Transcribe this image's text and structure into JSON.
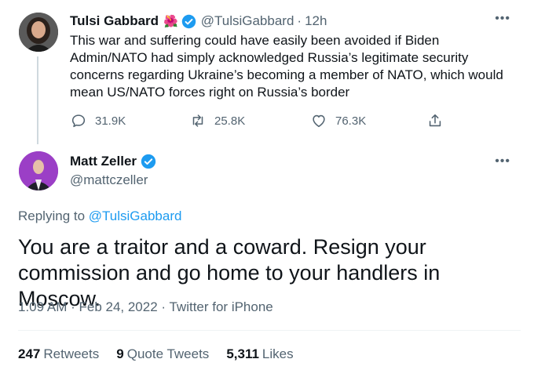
{
  "tweet1": {
    "author_name": "Tulsi Gabbard",
    "emoji": "🌺",
    "handle": "@TulsiGabbard",
    "separator": "·",
    "time": "12h",
    "more": "•••",
    "text": "This war and suffering could have easily been avoided if Biden Admin/NATO had simply acknowledged Russia’s legitimate security concerns regarding Ukraine’s becoming a member of NATO, which would mean US/NATO forces right on Russia’s border",
    "replies": "31.9K",
    "retweets": "25.8K",
    "likes": "76.3K"
  },
  "tweet2": {
    "author_name": "Matt Zeller",
    "handle": "@mattczeller",
    "more": "•••",
    "replying_prefix": "Replying to ",
    "replying_to": "@TulsiGabbard",
    "text": "You are a traitor and a coward. Resign your commission and go home to your handlers in Moscow.",
    "meta": "1:09 AM · Feb 24, 2022 · Twitter for iPhone",
    "retweets_count": "247",
    "retweets_label": "Retweets",
    "quotes_count": "9",
    "quotes_label": "Quote Tweets",
    "likes_count": "5,311",
    "likes_label": "Likes"
  },
  "colors": {
    "accent": "#1d9bf0",
    "text": "#0f1419",
    "secondary": "#536471"
  }
}
